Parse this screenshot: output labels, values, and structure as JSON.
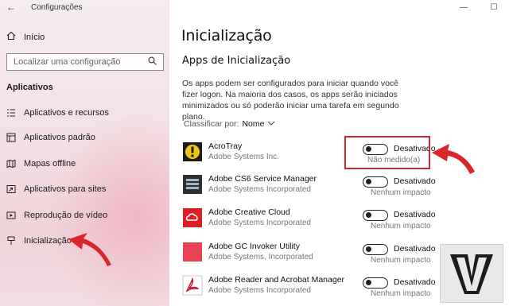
{
  "window": {
    "title": "Configurações",
    "controls": {
      "minimize": "—",
      "maximize": "☐"
    }
  },
  "sidebar": {
    "home_label": "Início",
    "search_placeholder": "Localizar uma configuração",
    "section_title": "Aplicativos",
    "items": [
      {
        "label": "Aplicativos e recursos",
        "icon": "apps-list-icon"
      },
      {
        "label": "Aplicativos padrão",
        "icon": "default-apps-icon"
      },
      {
        "label": "Mapas offline",
        "icon": "map-icon"
      },
      {
        "label": "Aplicativos para sites",
        "icon": "web-apps-icon"
      },
      {
        "label": "Reprodução de vídeo",
        "icon": "video-icon"
      },
      {
        "label": "Inicialização",
        "icon": "startup-icon"
      }
    ]
  },
  "main": {
    "title": "Inicialização",
    "subtitle": "Apps de Inicialização",
    "description": "Os apps podem ser configurados para iniciar quando você fizer logon. Na maioria dos casos, os apps serão iniciados minimizados ou só poderão iniciar uma tarefa em segundo plano.",
    "sort_label": "Classificar por:",
    "sort_value": "Nome",
    "apps": [
      {
        "name": "AcroTray",
        "publisher": "Adobe Systems Inc.",
        "state": "Desativado",
        "impact": "Não medido(a)",
        "icon": "acrotray-icon",
        "color": "#f0c419"
      },
      {
        "name": "Adobe CS6 Service Manager",
        "publisher": "Adobe Systems Incorporated",
        "state": "Desativado",
        "impact": "Nenhum impacto",
        "icon": "cs6-service-manager-icon",
        "color": "#3a3a3a"
      },
      {
        "name": "Adobe Creative Cloud",
        "publisher": "Adobe Systems Incorporated",
        "state": "Desativado",
        "impact": "Nenhum impacto",
        "icon": "creative-cloud-icon",
        "color": "#da1f26"
      },
      {
        "name": "Adobe GC Invoker Utility",
        "publisher": "Adobe Systems, Incorporated",
        "state": "Desativado",
        "impact": "Nenhum impacto",
        "icon": "gc-invoker-icon",
        "color": "#e94257"
      },
      {
        "name": "Adobe Reader and Acrobat Manager",
        "publisher": "Adobe Systems Incorporated",
        "state": "Desativado",
        "impact": "Nenhum impacto",
        "icon": "acrobat-icon",
        "color": "#ffffff"
      }
    ]
  },
  "colors": {
    "highlight": "#d9262b",
    "arrow": "#d9262b"
  }
}
